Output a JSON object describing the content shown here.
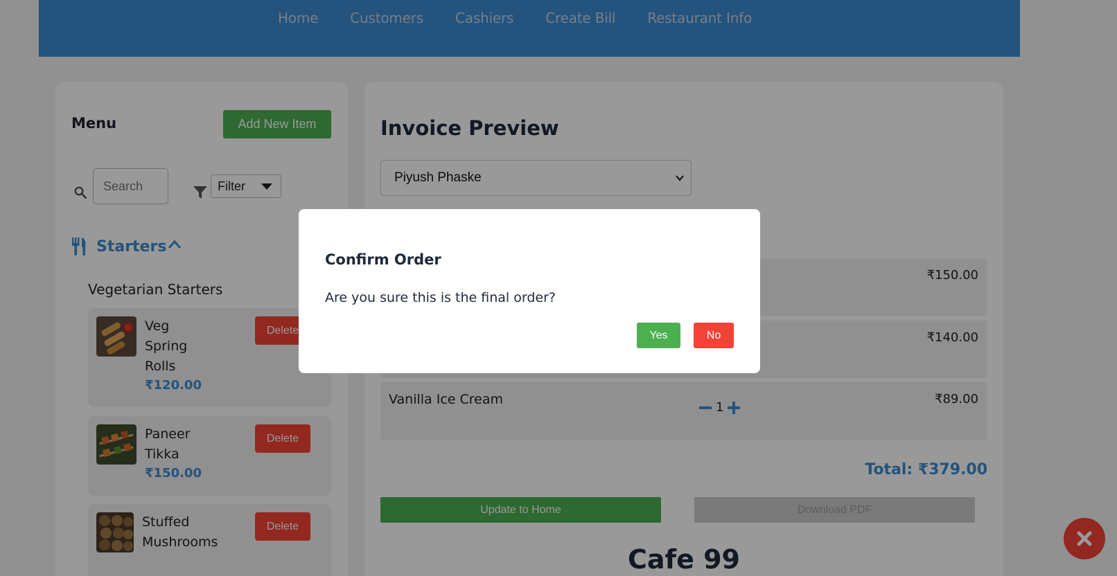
{
  "nav": {
    "links": [
      "Home",
      "Customers",
      "Cashiers",
      "Create Bill",
      "Restaurant Info"
    ]
  },
  "menu": {
    "title": "Menu",
    "add_button": "Add New Item",
    "search_placeholder": "Search",
    "filter_value": "Filter",
    "category": "Starters",
    "subcategory": "Vegetarian Starters",
    "delete_label": "Delete",
    "items": [
      {
        "name": "Veg Spring Rolls",
        "price": "₹120.00"
      },
      {
        "name": "Paneer Tikka",
        "price": "₹150.00"
      },
      {
        "name": "Stuffed Mushrooms",
        "price": ""
      }
    ]
  },
  "invoice": {
    "title": "Invoice Preview",
    "customer": "Piyush Phaske",
    "rows": [
      {
        "name": "",
        "qty": "",
        "price": "₹150.00"
      },
      {
        "name": "",
        "qty": "",
        "price": "₹140.00"
      },
      {
        "name": "Vanilla Ice Cream",
        "qty": "1",
        "price": "₹89.00"
      }
    ],
    "total": "Total: ₹379.00",
    "update_button": "Update to Home",
    "download_button": "Download PDF",
    "cafe_name": "Cafe 99"
  },
  "modal": {
    "title": "Confirm Order",
    "message": "Are you sure this is the final order?",
    "yes_label": "Yes",
    "no_label": "No"
  },
  "colors": {
    "nav_bg": "#3c8ad0",
    "accent_blue": "#3c8ad0",
    "green": "#4caf50",
    "red": "#f44336"
  }
}
